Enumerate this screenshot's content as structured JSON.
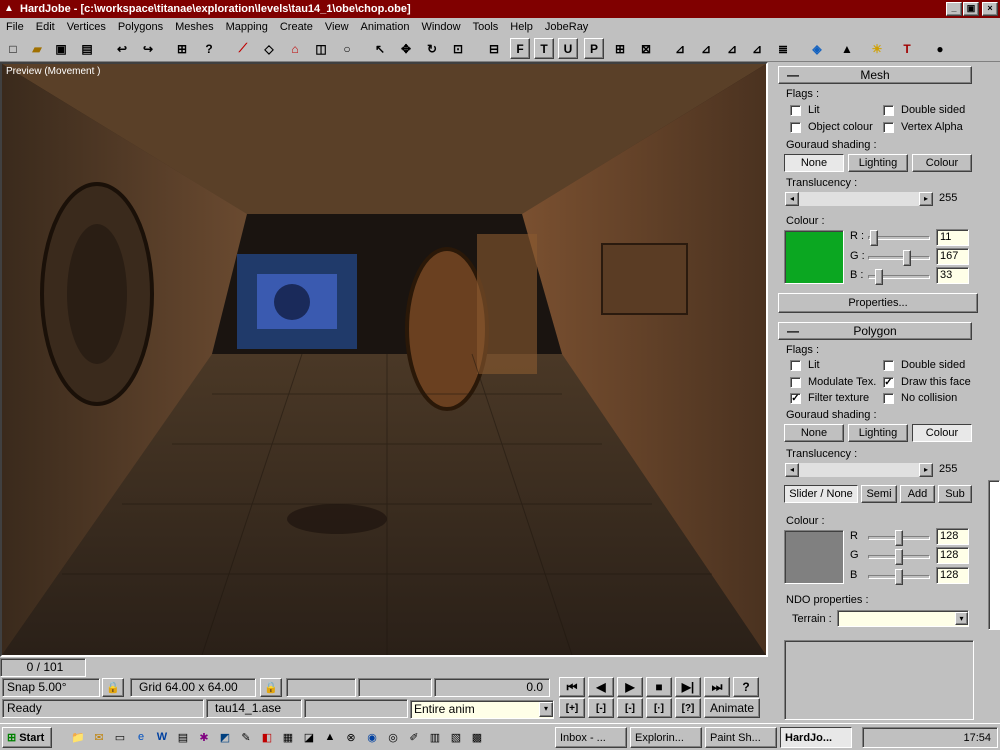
{
  "window": {
    "title": "HardJobe - [c:\\workspace\\titanae\\exploration\\levels\\tau14_1\\obe\\chop.obe]",
    "min": "_",
    "max": "▣",
    "close": "×"
  },
  "menu": [
    "File",
    "Edit",
    "Vertices",
    "Polygons",
    "Meshes",
    "Mapping",
    "Create",
    "View",
    "Animation",
    "Window",
    "Tools",
    "Help",
    "JobeRay"
  ],
  "toolbar_icons": [
    "new-icon",
    "open-icon",
    "save-icon",
    "save-all-icon",
    "undo-icon",
    "redo-icon",
    "import-icon",
    "help-icon",
    "vertex-tool-icon",
    "polygon-tool-icon",
    "house-icon",
    "cube-icon",
    "select-arrow-icon",
    "move-icon",
    "rotate-icon",
    "scale-icon",
    "top-view-icon",
    "front-view-icon",
    "t-view-icon",
    "u-view-icon",
    "p-view-icon",
    "zoom-in-icon",
    "zoom-fit-icon",
    "axis-x-icon",
    "axis-y-icon",
    "axis-z-icon",
    "axis-lock-icon",
    "notes-icon",
    "texture-icon",
    "shading-icon",
    "light-icon",
    "hammer-icon",
    "sphere-icon"
  ],
  "toolbar_text": [
    "F",
    "T",
    "U",
    "P"
  ],
  "viewport": {
    "label": "Preview (Movement )"
  },
  "mesh": {
    "title": "Mesh",
    "flags_label": "Flags :",
    "flags": [
      {
        "label": "Lit",
        "checked": false
      },
      {
        "label": "Double sided",
        "checked": false
      },
      {
        "label": "Object colour",
        "checked": false
      },
      {
        "label": "Vertex Alpha",
        "checked": false
      }
    ],
    "gouraud_label": "Gouraud shading :",
    "gouraud": [
      "None",
      "Lighting",
      "Colour"
    ],
    "gouraud_selected": "None",
    "translucency_label": "Translucency :",
    "translucency": "255",
    "colour_label": "Colour :",
    "colour": {
      "hex": "#0ba721",
      "r_label": "R :",
      "g_label": "G :",
      "b_label": "B :",
      "r": "11",
      "g": "167",
      "b": "33",
      "r_level": 0.04,
      "g_level": 0.65,
      "b_level": 0.13
    },
    "properties": "Properties..."
  },
  "polygon": {
    "title": "Polygon",
    "flags_label": "Flags :",
    "flags": [
      {
        "label": "Lit",
        "checked": false
      },
      {
        "label": "Double sided",
        "checked": false
      },
      {
        "label": "Modulate Tex.",
        "checked": false
      },
      {
        "label": "Draw this face",
        "checked": true
      },
      {
        "label": "Filter texture",
        "checked": true
      },
      {
        "label": "No collision",
        "checked": false
      }
    ],
    "gouraud_label": "Gouraud shading :",
    "gouraud": [
      "None",
      "Lighting",
      "Colour"
    ],
    "gouraud_selected": "Colour",
    "translucency_label": "Translucency :",
    "translucency": "255",
    "blend": [
      "Slider / None",
      "Semi",
      "Add",
      "Sub"
    ],
    "blend_selected": "Slider / None",
    "colour_label": "Colour :",
    "colour": {
      "hex": "#808080",
      "r_label": "R",
      "g_label": "G",
      "b_label": "B",
      "r": "128",
      "g": "128",
      "b": "128",
      "r_level": 0.5,
      "g_level": 0.5,
      "b_level": 0.5
    },
    "ndo_label": "NDO properties :",
    "terrain_label": "Terrain :",
    "terrain": ""
  },
  "status": {
    "frame": "0 / 101",
    "snap": "Snap 5.00°",
    "grid": "Grid 64.00 x 64.00",
    "time": "0.0",
    "ready": "Ready",
    "file": "tau14_1.ase",
    "anim_select": "Entire anim",
    "animate": "Animate",
    "play_buttons": [
      "⏮",
      "◀",
      "▶",
      "■",
      "▶|",
      "⏭",
      "?"
    ],
    "key_buttons": [
      "[+]",
      "[-]",
      "[-]",
      "[·]",
      "[?]"
    ]
  },
  "taskbar": {
    "start": "Start",
    "tasks": [
      "Inbox - ...",
      "Explorin...",
      "Paint Sh...",
      "HardJo..."
    ],
    "active_task": "HardJo...",
    "clock": "17:54",
    "quick_icons": [
      "explorer-icon",
      "outlook-icon",
      "desktop-icon",
      "ie-icon",
      "word-icon",
      "doc-icon",
      "gear-icon",
      "photoshop-icon",
      "tools-icon",
      "pdf-icon",
      "calc-icon",
      "dot-icon",
      "graph-icon",
      "bell-icon",
      "network-icon",
      "app-icon",
      "compass-icon",
      "pen-icon",
      "notes-icon",
      "book-icon",
      "folder-icon"
    ]
  }
}
